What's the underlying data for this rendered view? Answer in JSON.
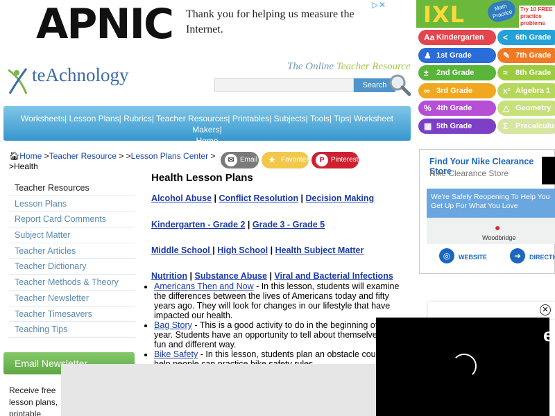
{
  "top_ad": {
    "brand": "APNIC",
    "text": "Thank you for helping us measure the Internet."
  },
  "header": {
    "logo_text": "teAchnology",
    "tagline_part1": "The Online ",
    "tagline_part2": "Teacher Resource",
    "search_button": "Search",
    "search_placeholder": ""
  },
  "nav": {
    "items": [
      "Worksheets",
      "Lesson Plans",
      "Rubrics",
      "Teacher Resources",
      "Printables",
      "Subjects",
      "Tools",
      "Tips",
      "Worksheet Makers",
      "Home"
    ]
  },
  "breadcrumb": {
    "home": "Home",
    "sep1": " >",
    "teacher_resource": "Teacher Resource",
    "sep2": " > >",
    "lesson_plans_center": "Lesson Plans Center",
    "sep3": " >",
    "current": ">Health"
  },
  "share": {
    "email": "Email",
    "favorites": "Favorites",
    "pinterest": "Pinterest"
  },
  "sidebar": {
    "items": [
      "Teacher Resources",
      "Lesson Plans",
      "Report Card Comments",
      "Subject Matter",
      "Teacher Articles",
      "Teacher Dictionary",
      "Teacher Methods & Theory",
      "Teacher Newsletter",
      "Teacher Timesavers",
      "Teaching Tips"
    ],
    "newsletter_title": "Email Newsletter",
    "newsletter_text": "Receive free lesson plans, printable worksheets by"
  },
  "main": {
    "title": "Health Lesson Plans",
    "row1": [
      "Alcohol Abuse",
      "Conflict Resolution",
      "Decision Making"
    ],
    "row2": [
      "Kindergarten - Grade 2",
      "Grade 3 - Grade 5"
    ],
    "row3": [
      "Middle School ",
      "High School",
      "Health Subject Matter"
    ],
    "row4": [
      "Nutrition",
      "Substance Abuse",
      "Viral and Bacterial Infections"
    ],
    "sep": " | ",
    "lessons": [
      {
        "title": "Americans Then and Now",
        "text": " - In this lesson, students will examine the differences between the lives of Americans today and fifty years ago. They will look for changes in our lifestyle that have impacted our health."
      },
      {
        "title": "Bag Story",
        "text": " - This is a good activity to do in the beginning of the year. Students have an opportunity to tell about themselves in a fun and different way."
      },
      {
        "title": "Bike Safety",
        "text": " - In this lesson, students plan an obstacle course to help people can practice bike safety rules."
      }
    ]
  },
  "right_ad": {
    "logo": "IXL",
    "badge": "Math Practice",
    "try": "Try 10 FREE practice problems",
    "grades": [
      {
        "label": "Kindergarten",
        "sym": "Aa",
        "color": "#e4454c"
      },
      {
        "label": "6th Grade",
        "sym": "<",
        "color": "#23a1d8"
      },
      {
        "label": "1st Grade",
        "sym": "♟",
        "color": "#2a6cd8"
      },
      {
        "label": "7th Grade",
        "sym": "✎",
        "color": "#f07a24"
      },
      {
        "label": "2nd Grade",
        "sym": "±",
        "color": "#59b43a"
      },
      {
        "label": "8th Grade",
        "sym": "≈",
        "color": "#9bcc3f"
      },
      {
        "label": "3rd Grade",
        "sym": "∞",
        "color": "#f1a820"
      },
      {
        "label": "Algebra 1",
        "sym": "x²",
        "color": "#b6d85a"
      },
      {
        "label": "4th Grade",
        "sym": "%",
        "color": "#b64ed6"
      },
      {
        "label": "Geometry",
        "sym": "△",
        "color": "#c6e07a"
      },
      {
        "label": "5th Grade",
        "sym": "▦",
        "color": "#7c3fc6"
      },
      {
        "label": "Precalculu",
        "sym": "Σ",
        "color": "#d6e6a0"
      }
    ]
  },
  "nike_ad": {
    "title": "Find Your Nike Clearance Store",
    "subtitle": "Nike Clearance Store",
    "banner": "We're Safely Reopening To Help You Get Up For What You Love",
    "map_label": "Woodbridge",
    "website": "WEBSITE",
    "directions": "DIRECTIO"
  },
  "video": {
    "edge_text": "e"
  }
}
